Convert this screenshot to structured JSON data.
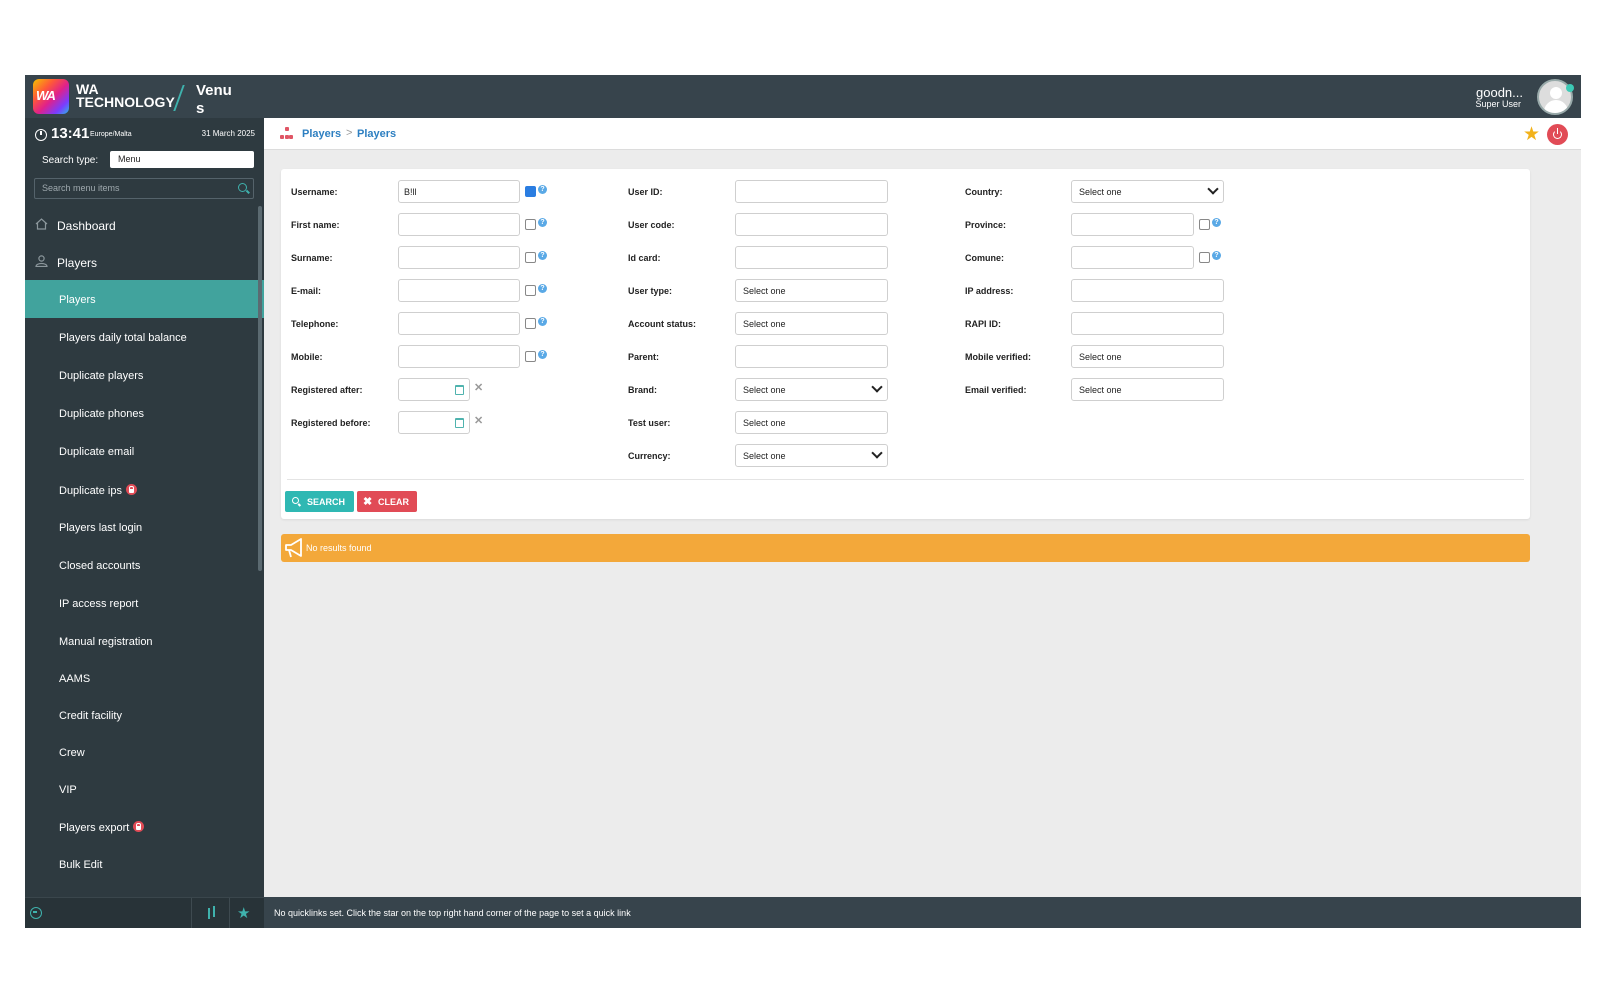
{
  "header": {
    "logo_text": "WA",
    "brand_line1": "WA",
    "brand_line2": "TECHNOLOGY",
    "venue": "Venus",
    "user_name": "goodn...",
    "user_role": "Super User"
  },
  "sidebar": {
    "time": "13:41",
    "timezone": "Europe/Malta",
    "date": "31 March 2025",
    "search_type_label": "Search type:",
    "search_type_value": "Menu",
    "search_placeholder": "Search menu items",
    "items": [
      {
        "label": "Dashboard",
        "level": "top",
        "icon": "home-icon"
      },
      {
        "label": "Players",
        "level": "top",
        "icon": "user-icon"
      },
      {
        "label": "Players",
        "level": "sub",
        "active": true
      },
      {
        "label": "Players daily total balance",
        "level": "sub"
      },
      {
        "label": "Duplicate players",
        "level": "sub"
      },
      {
        "label": "Duplicate phones",
        "level": "sub"
      },
      {
        "label": "Duplicate email",
        "level": "sub"
      },
      {
        "label": "Duplicate ips",
        "level": "sub",
        "locked": true
      },
      {
        "label": "Players last login",
        "level": "sub"
      },
      {
        "label": "Closed accounts",
        "level": "sub"
      },
      {
        "label": "IP access report",
        "level": "sub"
      },
      {
        "label": "Manual registration",
        "level": "sub"
      },
      {
        "label": "AAMS",
        "level": "sub"
      },
      {
        "label": "Credit facility",
        "level": "sub"
      },
      {
        "label": "Crew",
        "level": "sub"
      },
      {
        "label": "VIP",
        "level": "sub"
      },
      {
        "label": "Players export",
        "level": "sub",
        "locked": true
      },
      {
        "label": "Bulk Edit",
        "level": "sub"
      }
    ]
  },
  "breadcrumb": {
    "section": "Players",
    "separator": ">",
    "page": "Players"
  },
  "filters": {
    "col1": {
      "username_label": "Username:",
      "username_value": "B!ll",
      "first_name_label": "First name:",
      "surname_label": "Surname:",
      "email_label": "E-mail:",
      "telephone_label": "Telephone:",
      "mobile_label": "Mobile:",
      "registered_after_label": "Registered after:",
      "registered_before_label": "Registered before:"
    },
    "col2": {
      "user_id_label": "User ID:",
      "user_code_label": "User code:",
      "id_card_label": "Id card:",
      "user_type_label": "User type:",
      "user_type_value": "Select one",
      "account_status_label": "Account status:",
      "account_status_value": "Select one",
      "parent_label": "Parent:",
      "brand_label": "Brand:",
      "brand_value": "Select one",
      "test_user_label": "Test user:",
      "test_user_value": "Select one",
      "currency_label": "Currency:",
      "currency_value": "Select one"
    },
    "col3": {
      "country_label": "Country:",
      "country_value": "Select one",
      "province_label": "Province:",
      "comune_label": "Comune:",
      "ip_address_label": "IP address:",
      "rapi_id_label": "RAPI ID:",
      "mobile_verified_label": "Mobile verified:",
      "mobile_verified_value": "Select one",
      "email_verified_label": "Email verified:",
      "email_verified_value": "Select one"
    },
    "help_glyph": "?",
    "search_label": "SEARCH",
    "clear_label": "CLEAR"
  },
  "results": {
    "message": "No results found"
  },
  "quicklinks": {
    "message": "No quicklinks set. Click the star on the top right hand corner of the page to set a quick link"
  },
  "colors": {
    "topbar": "#37444c",
    "sidebar": "#2e3a40",
    "accent": "#41a39d",
    "warning": "#f3a83a",
    "danger": "#e14b56",
    "link": "#2d7fc1"
  }
}
